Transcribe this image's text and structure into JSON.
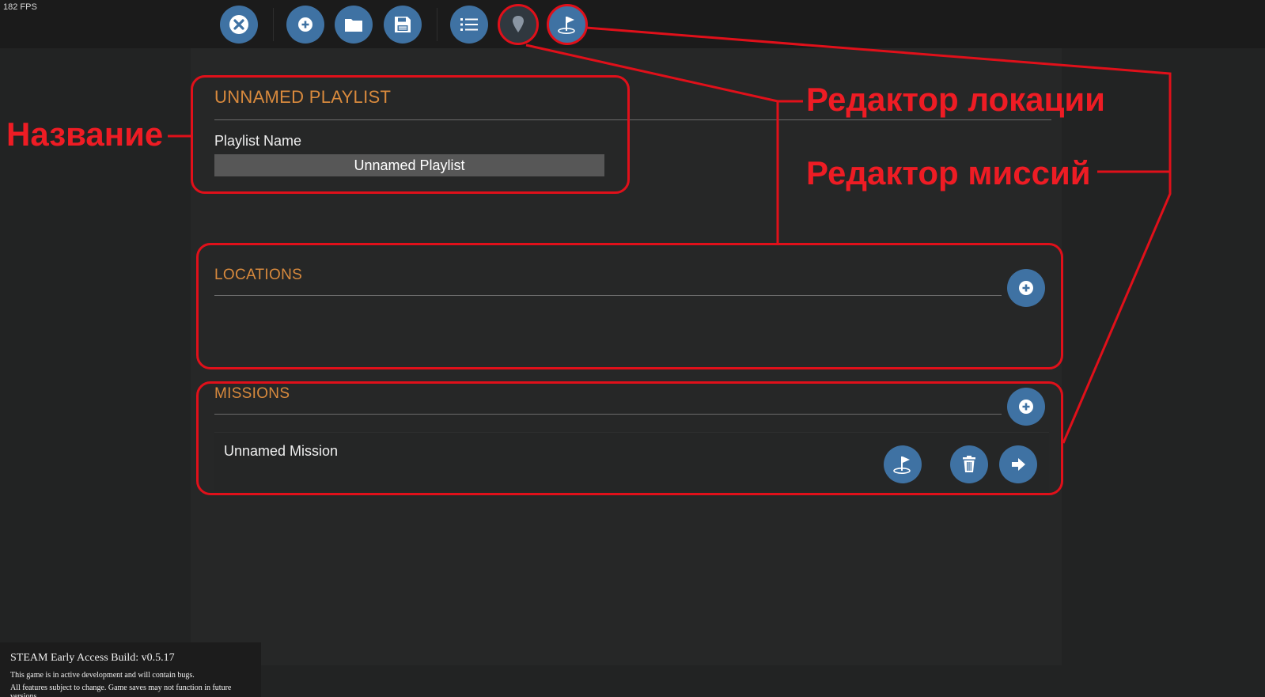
{
  "fps": "182 FPS",
  "toolbar": {
    "close": "close-icon",
    "new": "plus-icon",
    "open": "folder-icon",
    "save": "floppy-icon",
    "playlist": "list-icon",
    "location_editor": "map-pin-icon",
    "mission_editor": "golf-flag-icon"
  },
  "playlist": {
    "title": "UNNAMED PLAYLIST",
    "name_label": "Playlist Name",
    "name_value": "Unnamed Playlist"
  },
  "locations": {
    "title": "LOCATIONS"
  },
  "missions": {
    "title": "MISSIONS",
    "items": [
      {
        "name": "Unnamed Mission"
      }
    ]
  },
  "annotations": {
    "name": "Название",
    "location_editor": "Редактор локации",
    "mission_editor": "Редактор миссий"
  },
  "build": {
    "line1": "STEAM Early Access Build: v0.5.17",
    "line2": "This game is in active development and will contain bugs.",
    "line3": "All features subject to change. Game saves may not function in future versions."
  },
  "colors": {
    "accent_orange": "#d98a3d",
    "button_blue": "#3f72a3",
    "annotation_red": "#e0101a"
  }
}
